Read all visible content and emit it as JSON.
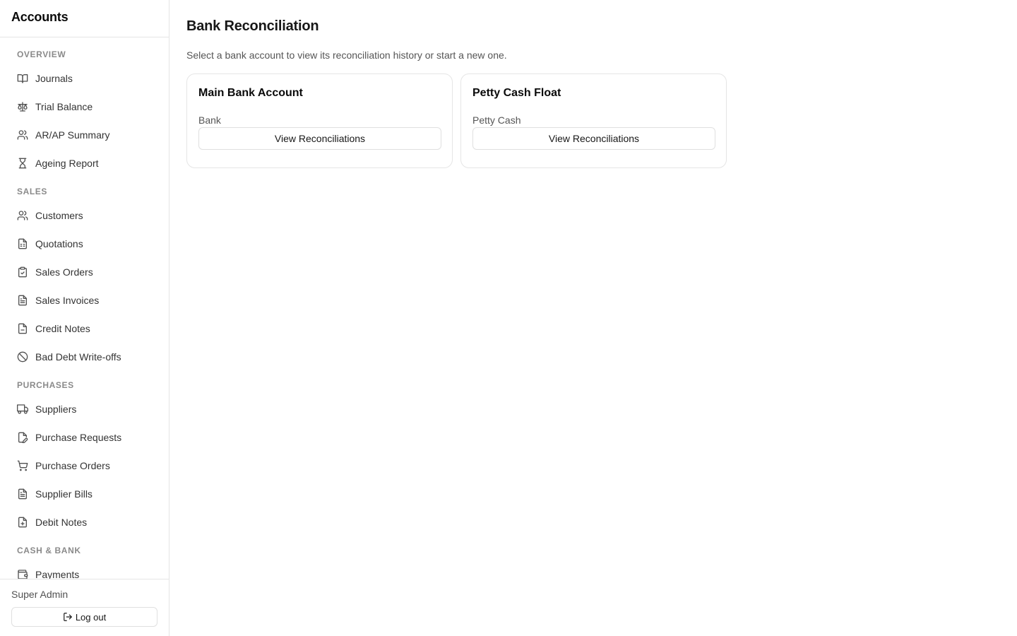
{
  "app": {
    "title": "Accounts"
  },
  "sidebar": {
    "sections": [
      {
        "label": "OVERVIEW",
        "items": [
          {
            "label": "Journals",
            "icon": "book-open-icon"
          },
          {
            "label": "Trial Balance",
            "icon": "scale-icon"
          },
          {
            "label": "AR/AP Summary",
            "icon": "users-icon"
          },
          {
            "label": "Ageing Report",
            "icon": "hourglass-icon"
          }
        ]
      },
      {
        "label": "SALES",
        "items": [
          {
            "label": "Customers",
            "icon": "users-icon"
          },
          {
            "label": "Quotations",
            "icon": "file-spreadsheet-icon"
          },
          {
            "label": "Sales Orders",
            "icon": "clipboard-check-icon"
          },
          {
            "label": "Sales Invoices",
            "icon": "file-text-icon"
          },
          {
            "label": "Credit Notes",
            "icon": "file-minus-icon"
          },
          {
            "label": "Bad Debt Write-offs",
            "icon": "ban-icon"
          }
        ]
      },
      {
        "label": "PURCHASES",
        "items": [
          {
            "label": "Suppliers",
            "icon": "truck-icon"
          },
          {
            "label": "Purchase Requests",
            "icon": "file-pen-icon"
          },
          {
            "label": "Purchase Orders",
            "icon": "shopping-cart-icon"
          },
          {
            "label": "Supplier Bills",
            "icon": "file-text-icon"
          },
          {
            "label": "Debit Notes",
            "icon": "file-plus-icon"
          }
        ]
      },
      {
        "label": "CASH & BANK",
        "items": [
          {
            "label": "Payments",
            "icon": "wallet-icon"
          }
        ]
      }
    ],
    "footer": {
      "user_name": "Super Admin",
      "logout_label": "Log out",
      "logout_icon": "log-out-icon"
    }
  },
  "main": {
    "title": "Bank Reconciliation",
    "subtitle": "Select a bank account to view its reconciliation history or start a new one.",
    "accounts": [
      {
        "name": "Main Bank Account",
        "type": "Bank",
        "button_label": "View Reconciliations"
      },
      {
        "name": "Petty Cash Float",
        "type": "Petty Cash",
        "button_label": "View Reconciliations"
      }
    ]
  }
}
